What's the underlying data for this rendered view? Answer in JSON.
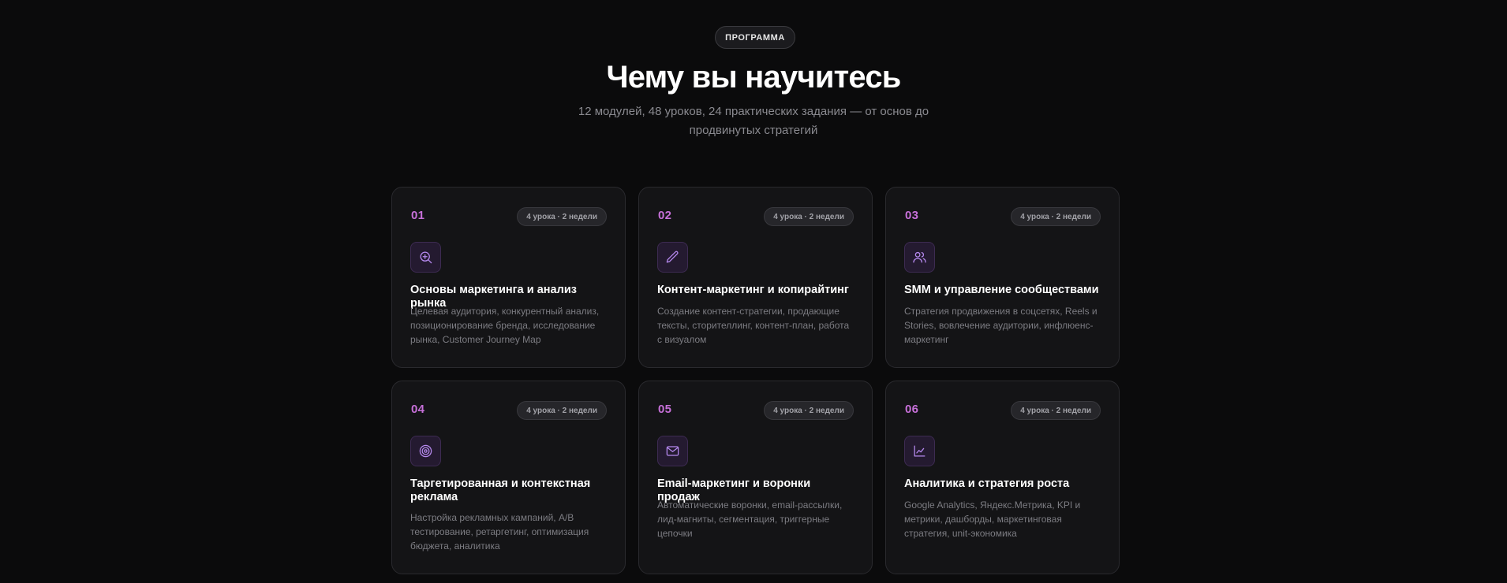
{
  "section": {
    "pill_label": "ПРОГРАММА",
    "title": "Чему вы научитесь",
    "subtitle": "12 модулей, 48 уроков, 24 практических задания — от основ до продвинутых стратегий"
  },
  "colors": {
    "background": "#0b0b0c",
    "card_background": "#141416",
    "accent_number": "#c770d9",
    "icon_stroke": "#b78af0"
  },
  "modules": [
    {
      "number": "01",
      "meta": "4 урока · 2 недели",
      "icon": "search-icon",
      "title": "Основы маркетинга и анализ рынка",
      "description": "Целевая аудитория, конкурентный анализ, позиционирование бренда, исследование рынка, Customer Journey Map"
    },
    {
      "number": "02",
      "meta": "4 урока · 2 недели",
      "icon": "pencil-icon",
      "title": "Контент-маркетинг и копирайтинг",
      "description": "Создание контент-стратегии, продающие тексты, сторителлинг, контент-план, работа с визуалом"
    },
    {
      "number": "03",
      "meta": "4 урока · 2 недели",
      "icon": "users-icon",
      "title": "SMM и управление сообществами",
      "description": "Стратегия продвижения в соцсетях, Reels и Stories, вовлечение аудитории, инфлюенс-маркетинг"
    },
    {
      "number": "04",
      "meta": "4 урока · 2 недели",
      "icon": "target-icon",
      "title": "Таргетированная и контекстная реклама",
      "description": "Настройка рекламных кампаний, A/B тестирование, ретаргетинг, оптимизация бюджета, аналитика"
    },
    {
      "number": "05",
      "meta": "4 урока · 2 недели",
      "icon": "mail-icon",
      "title": "Email-маркетинг и воронки продаж",
      "description": "Автоматические воронки, email-рассылки, лид-магниты, сегментация, триггерные цепочки"
    },
    {
      "number": "06",
      "meta": "4 урока · 2 недели",
      "icon": "chart-icon",
      "title": "Аналитика и стратегия роста",
      "description": "Google Analytics, Яндекс.Метрика, KPI и метрики, дашборды, маркетинговая стратегия, unit-экономика"
    }
  ]
}
